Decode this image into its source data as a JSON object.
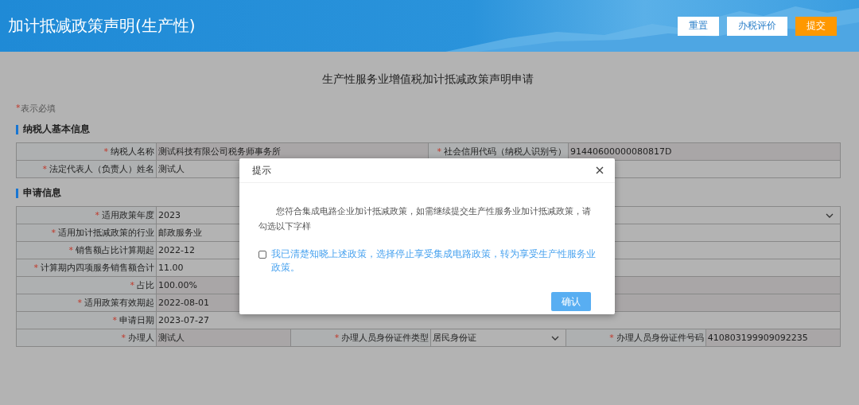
{
  "header": {
    "title": "加计抵减政策声明(生产性)",
    "buttons": [
      {
        "label": "重置",
        "kind": "default"
      },
      {
        "label": "办税评价",
        "kind": "default"
      },
      {
        "label": "提交",
        "kind": "primary"
      }
    ]
  },
  "form": {
    "title": "生产性服务业增值税加计抵减政策声明申请",
    "required_note": {
      "mark": "*",
      "text": "表示必填"
    },
    "sections": [
      {
        "title": "纳税人基本信息",
        "rows": [
          {
            "cells": [
              {
                "kind": "label",
                "text": "纳税人名称",
                "required": true
              },
              {
                "kind": "value",
                "text": "测试科技有限公司税务师事务所",
                "readonly": true
              },
              {
                "kind": "label",
                "text": "社会信用代码（纳税人识别号）",
                "required": true
              },
              {
                "kind": "value",
                "text": "91440600000080817D",
                "readonly": true
              }
            ]
          },
          {
            "cells": [
              {
                "kind": "label",
                "text": "法定代表人（负责人）姓名",
                "required": true
              },
              {
                "kind": "value",
                "text": "测试人",
                "readonly": false
              }
            ]
          }
        ]
      },
      {
        "title": "申请信息",
        "rows": [
          {
            "cells": [
              {
                "kind": "label",
                "text": "适用政策年度",
                "required": true
              },
              {
                "kind": "select",
                "text": "2023",
                "readonly": false
              }
            ]
          },
          {
            "cells": [
              {
                "kind": "label",
                "text": "适用加计抵减政策的行业",
                "required": true
              },
              {
                "kind": "value",
                "text": "邮政服务业",
                "readonly": false
              }
            ]
          },
          {
            "cells": [
              {
                "kind": "label",
                "text": "销售额占比计算期起",
                "required": true
              },
              {
                "kind": "value",
                "text": "2022-12",
                "readonly": false
              }
            ]
          },
          {
            "cells": [
              {
                "kind": "label",
                "text": "计算期内四项服务销售额合计",
                "required": true
              },
              {
                "kind": "value",
                "text": "11.00",
                "readonly": false
              }
            ]
          },
          {
            "cells": [
              {
                "kind": "label",
                "text": "占比",
                "required": true
              },
              {
                "kind": "value",
                "text": "100.00%",
                "readonly": true
              }
            ]
          },
          {
            "cells": [
              {
                "kind": "label",
                "text": "适用政策有效期起",
                "required": true
              },
              {
                "kind": "value",
                "text": "2022-08-01",
                "readonly": true
              }
            ]
          },
          {
            "cells": [
              {
                "kind": "label",
                "text": "申请日期",
                "required": true
              },
              {
                "kind": "value",
                "text": "2023-07-27",
                "readonly": false
              }
            ]
          },
          {
            "cells": [
              {
                "kind": "label",
                "text": "办理人",
                "required": true
              },
              {
                "kind": "value",
                "text": "测试人",
                "readonly": true
              },
              {
                "kind": "label",
                "text": "办理人员身份证件类型",
                "required": true
              },
              {
                "kind": "select",
                "text": "居民身份证",
                "readonly": false
              },
              {
                "kind": "label",
                "text": "办理人员身份证件号码",
                "required": true
              },
              {
                "kind": "value",
                "text": "410803199909092235",
                "readonly": true
              }
            ]
          }
        ]
      }
    ]
  },
  "dialog": {
    "title": "提示",
    "message": "您符合集成电路企业加计抵减政策，如需继续提交生产性服务业加计抵减政策，请勾选以下字样",
    "checkbox": {
      "label": "我已清楚知晓上述政策，选择停止享受集成电路政策，转为享受生产性服务业政策。",
      "checked": false
    },
    "button": {
      "label": "确认",
      "disabled": true
    }
  }
}
